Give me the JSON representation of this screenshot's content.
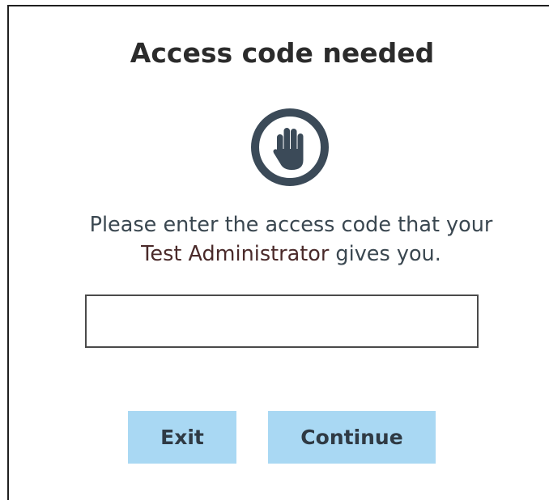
{
  "dialog": {
    "title": "Access code needed",
    "icon": "stop-hand-icon",
    "message_part1": "Please enter the access code that your",
    "message_part2_highlight": "Test Administrator",
    "message_part3": " gives you.",
    "input": {
      "value": "",
      "placeholder": ""
    },
    "buttons": {
      "exit_label": "Exit",
      "continue_label": "Continue"
    }
  },
  "colors": {
    "button_bg": "#a9d8f3",
    "icon_color": "#3b4a58",
    "text_color": "#3a4750"
  }
}
